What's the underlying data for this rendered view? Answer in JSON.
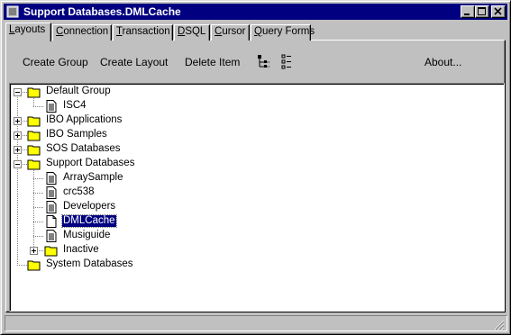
{
  "window": {
    "title": "Support Databases.DMLCache"
  },
  "tabs": [
    {
      "hotkey": "L",
      "rest": "ayouts",
      "active": true
    },
    {
      "hotkey": "C",
      "rest": "onnection",
      "active": false
    },
    {
      "hotkey": "T",
      "rest": "ransaction",
      "active": false
    },
    {
      "hotkey": "D",
      "rest": "SQL",
      "active": false
    },
    {
      "hotkey": "C",
      "rest": "ursor",
      "active": false
    },
    {
      "hotkey": "Q",
      "rest": "uery Forms",
      "active": false
    }
  ],
  "toolbar": {
    "create_group": "Create Group",
    "create_layout": "Create Layout",
    "delete_item": "Delete Item",
    "about": "About..."
  },
  "tree": {
    "default_group": "Default Group",
    "isc4": "ISC4",
    "ibo_applications": "IBO Applications",
    "ibo_samples": "IBO Samples",
    "sos_databases": "SOS Databases",
    "support_databases": "Support Databases",
    "array_sample": "ArraySample",
    "crc538": "crc538",
    "developers": "Developers",
    "dmlcache": "DMLCache",
    "musiguide": "Musiguide",
    "inactive": "Inactive",
    "system_databases": "System Databases"
  },
  "colors": {
    "titlebar": "#000080",
    "face": "#c0c0c0",
    "folder": "#ffff00",
    "selection": "#000080"
  }
}
